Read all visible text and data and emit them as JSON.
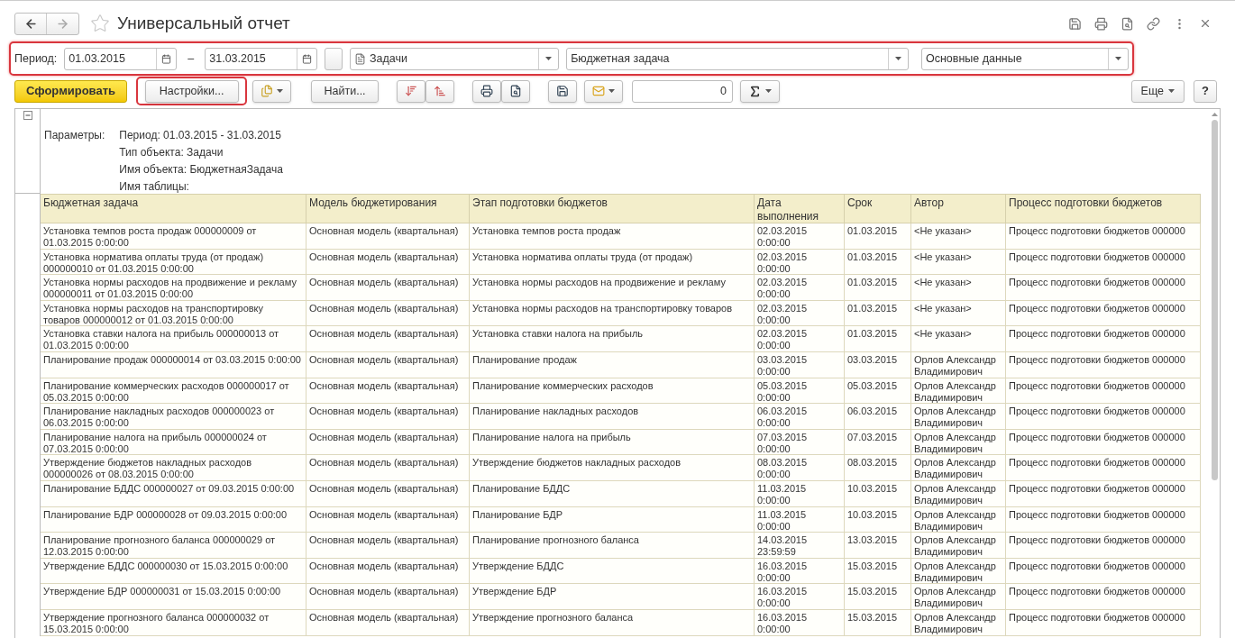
{
  "window": {
    "title": "Универсальный отчет"
  },
  "filters": {
    "period_label": "Период:",
    "date_from": "01.03.2015",
    "dash": "–",
    "date_to": "31.03.2015",
    "object_type": "Задачи",
    "object_name": "Бюджетная задача",
    "table_name": "Основные данные"
  },
  "toolbar": {
    "generate": "Сформировать",
    "settings": "Настройки...",
    "find": "Найти...",
    "number": "0",
    "more": "Еще",
    "help": "?"
  },
  "parameters": {
    "label": "Параметры:",
    "lines": [
      "Период: 01.03.2015 - 31.03.2015",
      "Тип объекта: Задачи",
      "Имя объекта: БюджетнаяЗадача",
      "Имя таблицы:"
    ]
  },
  "table": {
    "columns": [
      "Бюджетная задача",
      "Модель бюджетирования",
      "Этап подготовки бюджетов",
      "Дата выполнения",
      "Срок",
      "Автор",
      "Процесс подготовки бюджетов"
    ],
    "rows": [
      [
        "Установка темпов роста продаж 000000009 от 01.03.2015 0:00:00",
        "Основная модель (квартальная)",
        "Установка темпов роста продаж",
        "02.03.2015 0:00:00",
        "01.03.2015",
        "<Не указан>",
        "Процесс подготовки бюджетов 000000"
      ],
      [
        "Установка норматива оплаты труда (от продаж) 000000010 от 01.03.2015 0:00:00",
        "Основная модель (квартальная)",
        "Установка норматива оплаты труда (от продаж)",
        "02.03.2015 0:00:00",
        "01.03.2015",
        "<Не указан>",
        "Процесс подготовки бюджетов 000000"
      ],
      [
        "Установка нормы расходов на продвижение и рекламу 000000011 от 01.03.2015 0:00:00",
        "Основная модель (квартальная)",
        "Установка нормы расходов на продвижение и рекламу",
        "02.03.2015 0:00:00",
        "01.03.2015",
        "<Не указан>",
        "Процесс подготовки бюджетов 000000"
      ],
      [
        "Установка нормы расходов на транспортировку товаров 000000012 от 01.03.2015 0:00:00",
        "Основная модель (квартальная)",
        "Установка нормы расходов на транспортировку товаров",
        "02.03.2015 0:00:00",
        "01.03.2015",
        "<Не указан>",
        "Процесс подготовки бюджетов 000000"
      ],
      [
        "Установка ставки налога на прибыль 000000013 от 01.03.2015 0:00:00",
        "Основная модель (квартальная)",
        "Установка ставки налога на прибыль",
        "02.03.2015 0:00:00",
        "01.03.2015",
        "<Не указан>",
        "Процесс подготовки бюджетов 000000"
      ],
      [
        "Планирование продаж 000000014 от 03.03.2015 0:00:00",
        "Основная модель (квартальная)",
        "Планирование продаж",
        "03.03.2015 0:00:00",
        "03.03.2015",
        "Орлов Александр Владимирович",
        "Процесс подготовки бюджетов 000000"
      ],
      [
        "Планирование коммерческих расходов 000000017 от 05.03.2015 0:00:00",
        "Основная модель (квартальная)",
        "Планирование коммерческих расходов",
        "05.03.2015 0:00:00",
        "05.03.2015",
        "Орлов Александр Владимирович",
        "Процесс подготовки бюджетов 000000"
      ],
      [
        "Планирование накладных расходов 000000023 от 06.03.2015 0:00:00",
        "Основная модель (квартальная)",
        "Планирование накладных расходов",
        "06.03.2015 0:00:00",
        "06.03.2015",
        "Орлов Александр Владимирович",
        "Процесс подготовки бюджетов 000000"
      ],
      [
        "Планирование налога на прибыль 000000024 от 07.03.2015 0:00:00",
        "Основная модель (квартальная)",
        "Планирование налога на прибыль",
        "07.03.2015 0:00:00",
        "07.03.2015",
        "Орлов Александр Владимирович",
        "Процесс подготовки бюджетов 000000"
      ],
      [
        "Утверждение бюджетов накладных расходов 000000026 от 08.03.2015 0:00:00",
        "Основная модель (квартальная)",
        "Утверждение бюджетов накладных расходов",
        "08.03.2015 0:00:00",
        "08.03.2015",
        "Орлов Александр Владимирович",
        "Процесс подготовки бюджетов 000000"
      ],
      [
        "Планирование БДДС 000000027 от 09.03.2015 0:00:00",
        "Основная модель (квартальная)",
        "Планирование БДДС",
        "11.03.2015 0:00:00",
        "10.03.2015",
        "Орлов Александр Владимирович",
        "Процесс подготовки бюджетов 000000"
      ],
      [
        "Планирование БДР 000000028 от 09.03.2015 0:00:00",
        "Основная модель (квартальная)",
        "Планирование БДР",
        "11.03.2015 0:00:00",
        "10.03.2015",
        "Орлов Александр Владимирович",
        "Процесс подготовки бюджетов 000000"
      ],
      [
        "Планирование прогнозного баланса 000000029 от 12.03.2015 0:00:00",
        "Основная модель (квартальная)",
        "Планирование прогнозного баланса",
        "14.03.2015 23:59:59",
        "13.03.2015",
        "Орлов Александр Владимирович",
        "Процесс подготовки бюджетов 000000"
      ],
      [
        "Утверждение БДДС 000000030 от 15.03.2015 0:00:00",
        "Основная модель (квартальная)",
        "Утверждение БДДС",
        "16.03.2015 0:00:00",
        "15.03.2015",
        "Орлов Александр Владимирович",
        "Процесс подготовки бюджетов 000000"
      ],
      [
        "Утверждение БДР 000000031 от 15.03.2015 0:00:00",
        "Основная модель (квартальная)",
        "Утверждение БДР",
        "16.03.2015 0:00:00",
        "15.03.2015",
        "Орлов Александр Владимирович",
        "Процесс подготовки бюджетов 000000"
      ],
      [
        "Утверждение прогнозного баланса 000000032 от 15.03.2015 0:00:00",
        "Основная модель (квартальная)",
        "Утверждение прогнозного баланса",
        "16.03.2015 0:00:00",
        "15.03.2015",
        "Орлов Александр Владимирович",
        "Процесс подготовки бюджетов 000000"
      ]
    ]
  }
}
